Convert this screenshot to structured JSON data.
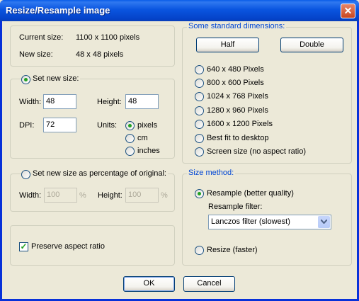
{
  "window": {
    "title": "Resize/Resample image",
    "close_label": "✕"
  },
  "info": {
    "current_size_label": "Current size:",
    "current_size_value": "1100  x  1100  pixels",
    "new_size_label": "New size:",
    "new_size_value": "48  x  48  pixels"
  },
  "set_new_size": {
    "label": "Set new size:",
    "width_label": "Width:",
    "width_value": "48",
    "height_label": "Height:",
    "height_value": "48",
    "dpi_label": "DPI:",
    "dpi_value": "72",
    "units_label": "Units:",
    "units": [
      "pixels",
      "cm",
      "inches"
    ],
    "selected_unit": "pixels"
  },
  "percentage": {
    "label": "Set new size as percentage of original:",
    "width_label": "Width:",
    "width_value": "100",
    "height_label": "Height:",
    "height_value": "100",
    "unit": "%"
  },
  "preserve_aspect_ratio": {
    "label": "Preserve aspect ratio",
    "checked": true
  },
  "standard_dimensions": {
    "title": "Some standard dimensions:",
    "half_label": "Half",
    "double_label": "Double",
    "options": [
      "640 x 480 Pixels",
      "800 x 600 Pixels",
      "1024 x 768 Pixels",
      "1280 x 960 Pixels",
      "1600 x 1200 Pixels",
      "Best fit to desktop",
      "Screen size (no aspect ratio)"
    ]
  },
  "size_method": {
    "title": "Size method:",
    "resample_label": "Resample (better quality)",
    "filter_label": "Resample filter:",
    "filter_value": "Lanczos filter (slowest)",
    "resize_label": "Resize (faster)"
  },
  "buttons": {
    "ok": "OK",
    "cancel": "Cancel"
  }
}
